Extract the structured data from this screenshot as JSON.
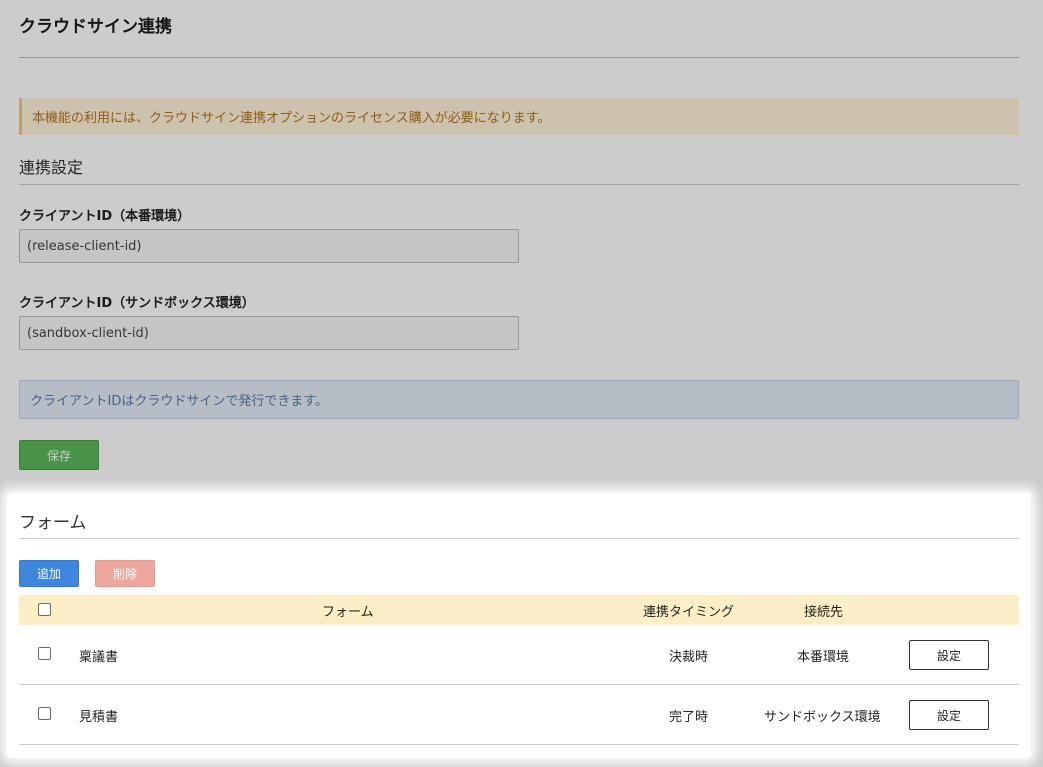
{
  "page": {
    "title": "クラウドサイン連携",
    "license_notice": "本機能の利用には、クラウドサイン連携オプションのライセンス購入が必要になります。"
  },
  "settings": {
    "heading": "連携設定",
    "release_label": "クライアントID（本番環境）",
    "release_value": "(release-client-id)",
    "sandbox_label": "クライアントID（サンドボックス環境）",
    "sandbox_value": "(sandbox-client-id)",
    "info": "クライアントIDはクラウドサインで発行できます。",
    "save_label": "保存"
  },
  "forms": {
    "heading": "フォーム",
    "add_label": "追加",
    "delete_label": "削除",
    "columns": {
      "form": "フォーム",
      "timing": "連携タイミング",
      "target": "接続先"
    },
    "rows": [
      {
        "form": "稟議書",
        "timing": "決裁時",
        "target": "本番環境",
        "action": "設定"
      },
      {
        "form": "見積書",
        "timing": "完了時",
        "target": "サンドボックス環境",
        "action": "設定"
      }
    ]
  },
  "colors": {
    "save": "#5cb85c",
    "add": "#3f86de",
    "delete": "#eea79e",
    "table_header": "#fdefc5",
    "warning_bg": "#fff3da",
    "info_bg": "#e5edf8"
  }
}
